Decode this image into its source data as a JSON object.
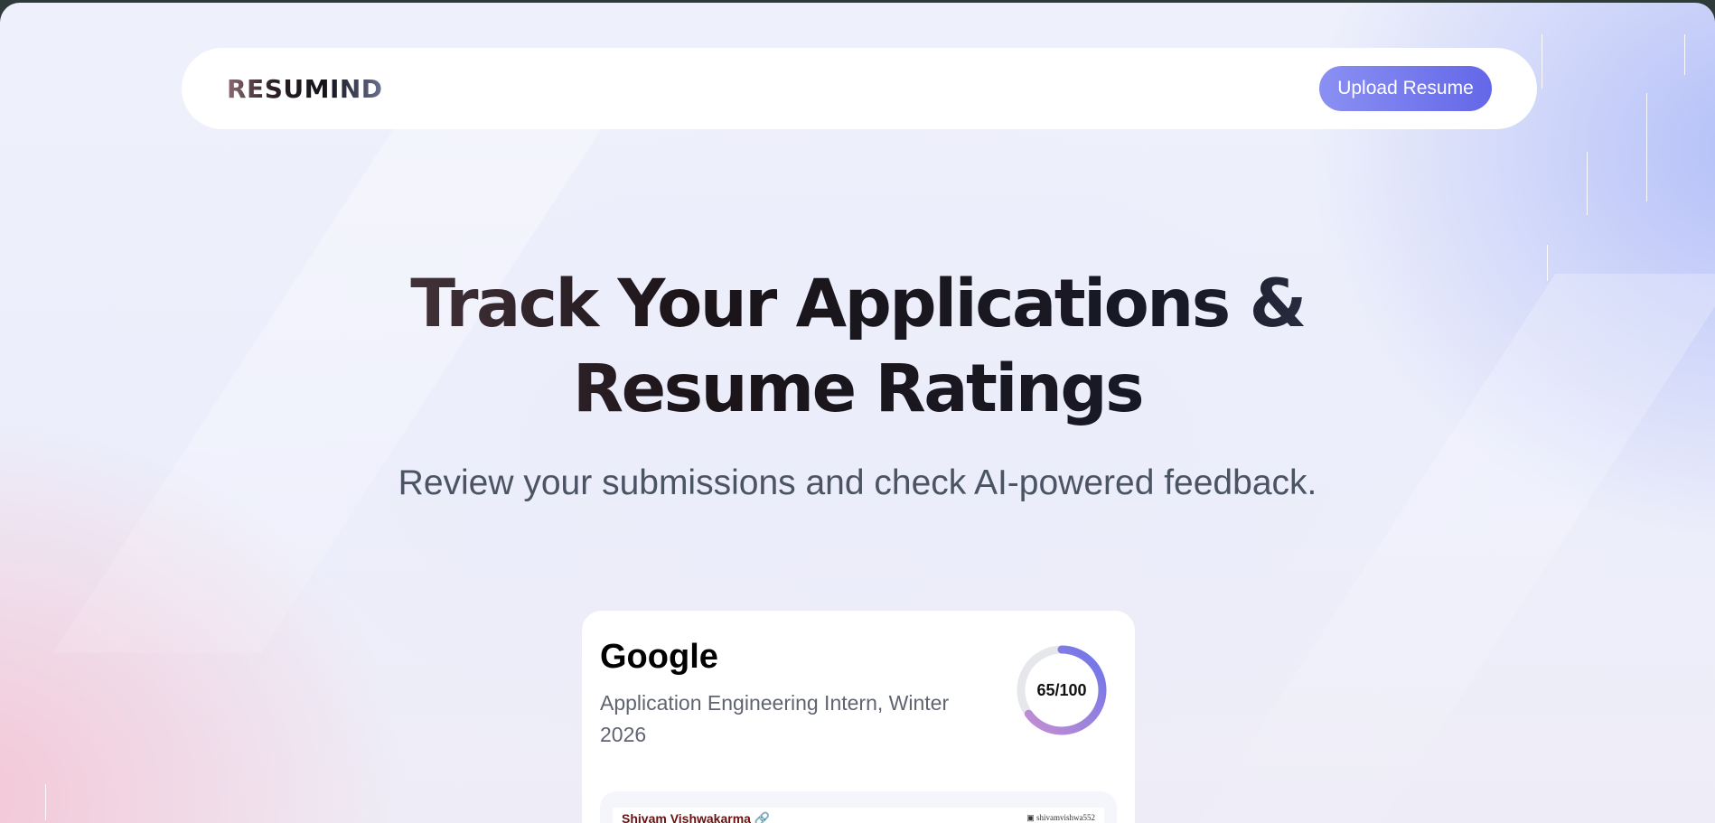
{
  "navbar": {
    "logo": "RESUMIND",
    "upload_label": "Upload Resume"
  },
  "hero": {
    "title_line1": "Track Your Applications &",
    "title_line2": "Resume Ratings",
    "subtitle": "Review your submissions and check AI-powered feedback."
  },
  "resume_card": {
    "company": "Google",
    "job_title": "Application Engineering Intern, Winter 2026",
    "score": 65,
    "score_text": "65/100",
    "preview_name": "Shivam Vishwakarma",
    "preview_contact": "shivamvishwa552"
  },
  "colors": {
    "accent": "#6467e8",
    "ring_start": "#c98fd0",
    "ring_end": "#6a74ec",
    "ring_track": "#e5e7eb"
  }
}
